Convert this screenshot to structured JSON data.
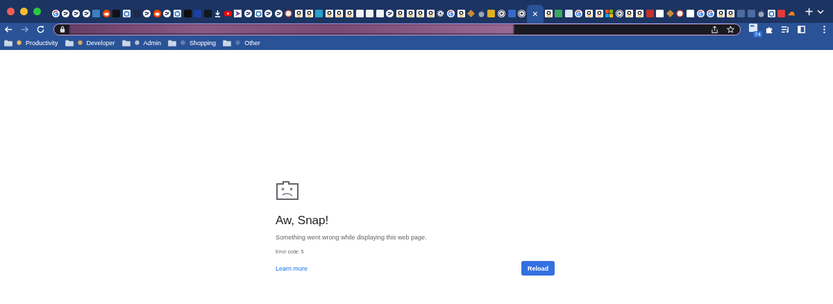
{
  "tabs": [
    {
      "kind": "google",
      "selected": false
    },
    {
      "kind": "globe",
      "selected": false
    },
    {
      "kind": "globe",
      "selected": false
    },
    {
      "kind": "globe",
      "selected": false
    },
    {
      "kind": "square",
      "color": "#3a7fc0",
      "selected": false
    },
    {
      "kind": "reddit",
      "selected": false
    },
    {
      "kind": "square",
      "color": "#111111",
      "selected": false
    },
    {
      "kind": "ring",
      "selected": false
    },
    {
      "kind": "square",
      "color": "#1b2a4a",
      "selected": false
    },
    {
      "kind": "globe",
      "selected": false
    },
    {
      "kind": "reddit",
      "selected": false
    },
    {
      "kind": "globe",
      "selected": false
    },
    {
      "kind": "ring",
      "selected": false
    },
    {
      "kind": "square",
      "color": "#0d0d0d",
      "selected": false
    },
    {
      "kind": "square",
      "color": "#1d3fa0",
      "selected": false
    },
    {
      "kind": "square",
      "color": "#101820",
      "selected": false
    },
    {
      "kind": "download",
      "selected": false
    },
    {
      "kind": "youtube",
      "selected": false
    },
    {
      "kind": "arrow",
      "selected": false
    },
    {
      "kind": "globe",
      "selected": false
    },
    {
      "kind": "ring",
      "selected": false
    },
    {
      "kind": "globe",
      "selected": false
    },
    {
      "kind": "globe",
      "selected": false
    },
    {
      "kind": "circle",
      "selected": false
    },
    {
      "kind": "amazon",
      "selected": false
    },
    {
      "kind": "amazon",
      "selected": false
    },
    {
      "kind": "square",
      "color": "#2aa0c8",
      "selected": false
    },
    {
      "kind": "amazon",
      "selected": false
    },
    {
      "kind": "amazon",
      "selected": false
    },
    {
      "kind": "amazon",
      "selected": false
    },
    {
      "kind": "square",
      "color": "#f2f2f2",
      "selected": false
    },
    {
      "kind": "square",
      "color": "#f2f2f2",
      "selected": false
    },
    {
      "kind": "square",
      "color": "#f2f2f2",
      "selected": false
    },
    {
      "kind": "globe",
      "selected": false
    },
    {
      "kind": "amazon",
      "selected": false
    },
    {
      "kind": "amazon",
      "selected": false
    },
    {
      "kind": "amazon",
      "selected": false
    },
    {
      "kind": "amazon",
      "selected": false
    },
    {
      "kind": "gear",
      "selected": false
    },
    {
      "kind": "google",
      "selected": false
    },
    {
      "kind": "amazon",
      "selected": false
    },
    {
      "kind": "diamond",
      "selected": false
    },
    {
      "kind": "apple",
      "selected": false
    },
    {
      "kind": "square",
      "color": "#e0b020",
      "selected": false
    },
    {
      "kind": "chrome",
      "selected": false
    },
    {
      "kind": "square",
      "color": "#3a6ac8",
      "selected": false
    },
    {
      "kind": "chrome",
      "selected": false
    },
    {
      "selected": true,
      "close": "×"
    },
    {
      "kind": "amazon",
      "selected": false
    },
    {
      "kind": "square",
      "color": "#3aa860",
      "selected": false
    },
    {
      "kind": "square",
      "color": "#dce6f2",
      "selected": false
    },
    {
      "kind": "google",
      "selected": false
    },
    {
      "kind": "amazon",
      "selected": false
    },
    {
      "kind": "amazon",
      "selected": false
    },
    {
      "kind": "microsoft",
      "selected": false
    },
    {
      "kind": "chrome",
      "selected": false
    },
    {
      "kind": "amazon",
      "selected": false
    },
    {
      "kind": "amazon",
      "selected": false
    },
    {
      "kind": "square",
      "color": "#c8302a",
      "selected": false
    },
    {
      "kind": "square",
      "color": "#ffffff",
      "selected": false
    },
    {
      "kind": "diamond",
      "selected": false
    },
    {
      "kind": "circle",
      "selected": false
    },
    {
      "kind": "square",
      "color": "#ffffff",
      "selected": false
    },
    {
      "kind": "google",
      "selected": false
    },
    {
      "kind": "google",
      "selected": false
    },
    {
      "kind": "amazon",
      "selected": false
    },
    {
      "kind": "amazon",
      "selected": false
    },
    {
      "kind": "square",
      "color": "#4a6aa0",
      "selected": false
    },
    {
      "kind": "square",
      "color": "#4a6aa0",
      "selected": false
    },
    {
      "kind": "apple",
      "selected": false
    },
    {
      "kind": "ring",
      "selected": false
    },
    {
      "kind": "square",
      "color": "#e03a3a",
      "selected": false
    },
    {
      "kind": "cloud",
      "selected": false
    }
  ],
  "new_tab": "+",
  "extension_badge": "74",
  "bookmarks": [
    {
      "label": "Productivity"
    },
    {
      "label": "Developer"
    },
    {
      "label": "Admin"
    },
    {
      "label": "Shopping"
    },
    {
      "label": "Other"
    }
  ],
  "error": {
    "title": "Aw, Snap!",
    "message": "Something went wrong while displaying this web page.",
    "code": "Error code: 5",
    "link": "Learn more",
    "button": "Reload"
  }
}
